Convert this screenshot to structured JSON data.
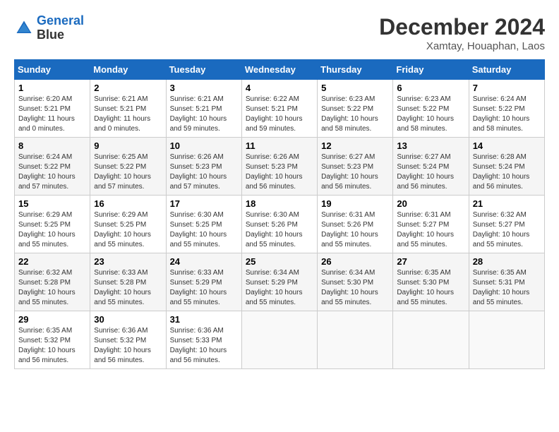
{
  "header": {
    "logo_line1": "General",
    "logo_line2": "Blue",
    "month_title": "December 2024",
    "location": "Xamtay, Houaphan, Laos"
  },
  "days_of_week": [
    "Sunday",
    "Monday",
    "Tuesday",
    "Wednesday",
    "Thursday",
    "Friday",
    "Saturday"
  ],
  "weeks": [
    [
      {
        "day": "1",
        "sunrise": "6:20 AM",
        "sunset": "5:21 PM",
        "daylight": "11 hours and 0 minutes."
      },
      {
        "day": "2",
        "sunrise": "6:21 AM",
        "sunset": "5:21 PM",
        "daylight": "11 hours and 0 minutes."
      },
      {
        "day": "3",
        "sunrise": "6:21 AM",
        "sunset": "5:21 PM",
        "daylight": "10 hours and 59 minutes."
      },
      {
        "day": "4",
        "sunrise": "6:22 AM",
        "sunset": "5:21 PM",
        "daylight": "10 hours and 59 minutes."
      },
      {
        "day": "5",
        "sunrise": "6:23 AM",
        "sunset": "5:22 PM",
        "daylight": "10 hours and 58 minutes."
      },
      {
        "day": "6",
        "sunrise": "6:23 AM",
        "sunset": "5:22 PM",
        "daylight": "10 hours and 58 minutes."
      },
      {
        "day": "7",
        "sunrise": "6:24 AM",
        "sunset": "5:22 PM",
        "daylight": "10 hours and 58 minutes."
      }
    ],
    [
      {
        "day": "8",
        "sunrise": "6:24 AM",
        "sunset": "5:22 PM",
        "daylight": "10 hours and 57 minutes."
      },
      {
        "day": "9",
        "sunrise": "6:25 AM",
        "sunset": "5:22 PM",
        "daylight": "10 hours and 57 minutes."
      },
      {
        "day": "10",
        "sunrise": "6:26 AM",
        "sunset": "5:23 PM",
        "daylight": "10 hours and 57 minutes."
      },
      {
        "day": "11",
        "sunrise": "6:26 AM",
        "sunset": "5:23 PM",
        "daylight": "10 hours and 56 minutes."
      },
      {
        "day": "12",
        "sunrise": "6:27 AM",
        "sunset": "5:23 PM",
        "daylight": "10 hours and 56 minutes."
      },
      {
        "day": "13",
        "sunrise": "6:27 AM",
        "sunset": "5:24 PM",
        "daylight": "10 hours and 56 minutes."
      },
      {
        "day": "14",
        "sunrise": "6:28 AM",
        "sunset": "5:24 PM",
        "daylight": "10 hours and 56 minutes."
      }
    ],
    [
      {
        "day": "15",
        "sunrise": "6:29 AM",
        "sunset": "5:25 PM",
        "daylight": "10 hours and 55 minutes."
      },
      {
        "day": "16",
        "sunrise": "6:29 AM",
        "sunset": "5:25 PM",
        "daylight": "10 hours and 55 minutes."
      },
      {
        "day": "17",
        "sunrise": "6:30 AM",
        "sunset": "5:25 PM",
        "daylight": "10 hours and 55 minutes."
      },
      {
        "day": "18",
        "sunrise": "6:30 AM",
        "sunset": "5:26 PM",
        "daylight": "10 hours and 55 minutes."
      },
      {
        "day": "19",
        "sunrise": "6:31 AM",
        "sunset": "5:26 PM",
        "daylight": "10 hours and 55 minutes."
      },
      {
        "day": "20",
        "sunrise": "6:31 AM",
        "sunset": "5:27 PM",
        "daylight": "10 hours and 55 minutes."
      },
      {
        "day": "21",
        "sunrise": "6:32 AM",
        "sunset": "5:27 PM",
        "daylight": "10 hours and 55 minutes."
      }
    ],
    [
      {
        "day": "22",
        "sunrise": "6:32 AM",
        "sunset": "5:28 PM",
        "daylight": "10 hours and 55 minutes."
      },
      {
        "day": "23",
        "sunrise": "6:33 AM",
        "sunset": "5:28 PM",
        "daylight": "10 hours and 55 minutes."
      },
      {
        "day": "24",
        "sunrise": "6:33 AM",
        "sunset": "5:29 PM",
        "daylight": "10 hours and 55 minutes."
      },
      {
        "day": "25",
        "sunrise": "6:34 AM",
        "sunset": "5:29 PM",
        "daylight": "10 hours and 55 minutes."
      },
      {
        "day": "26",
        "sunrise": "6:34 AM",
        "sunset": "5:30 PM",
        "daylight": "10 hours and 55 minutes."
      },
      {
        "day": "27",
        "sunrise": "6:35 AM",
        "sunset": "5:30 PM",
        "daylight": "10 hours and 55 minutes."
      },
      {
        "day": "28",
        "sunrise": "6:35 AM",
        "sunset": "5:31 PM",
        "daylight": "10 hours and 55 minutes."
      }
    ],
    [
      {
        "day": "29",
        "sunrise": "6:35 AM",
        "sunset": "5:32 PM",
        "daylight": "10 hours and 56 minutes."
      },
      {
        "day": "30",
        "sunrise": "6:36 AM",
        "sunset": "5:32 PM",
        "daylight": "10 hours and 56 minutes."
      },
      {
        "day": "31",
        "sunrise": "6:36 AM",
        "sunset": "5:33 PM",
        "daylight": "10 hours and 56 minutes."
      },
      null,
      null,
      null,
      null
    ]
  ]
}
